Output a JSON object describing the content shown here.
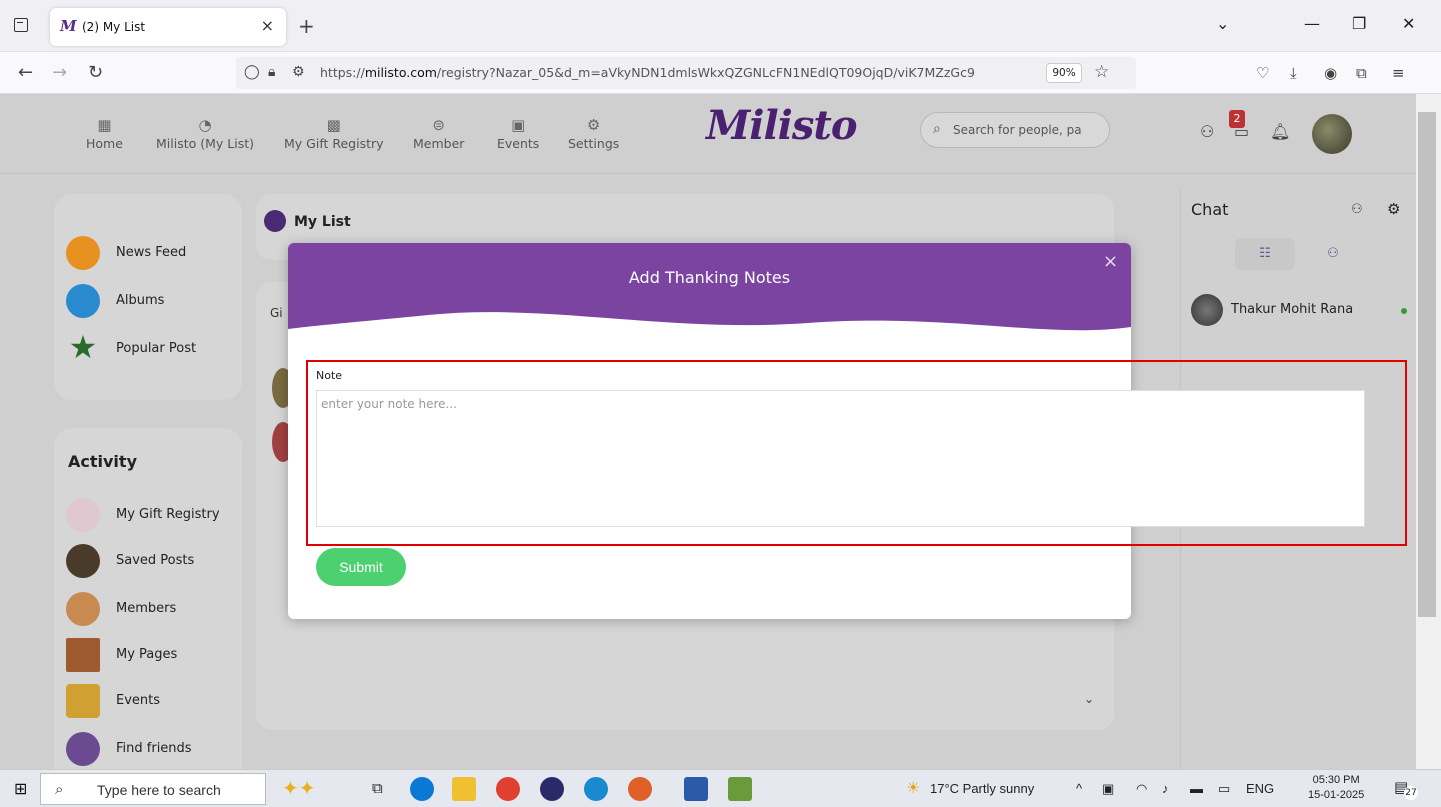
{
  "browser": {
    "tab_title": "(2) My List",
    "tab_favicon": "M",
    "url_prefix": "https://",
    "url_domain": "milisto.com",
    "url_path": "/registry?Nazar_05&d_m=aVkyNDN1dmlsWkxQZGNLcFN1NEdlQT09OjqD/viK7MZzGc9",
    "zoom": "90%"
  },
  "site": {
    "logo": "Milisto",
    "nav": [
      {
        "label": "Home",
        "icon": "grid-icon"
      },
      {
        "label": "Milisto (My List)",
        "icon": "chart-icon"
      },
      {
        "label": "My Gift Registry",
        "icon": "registry-icon"
      },
      {
        "label": "Member",
        "icon": "member-icon"
      },
      {
        "label": "Events",
        "icon": "calendar-icon"
      },
      {
        "label": "Settings",
        "icon": "gear-icon"
      }
    ],
    "search_placeholder": "Search for people, pa",
    "notif_badge": "2"
  },
  "sidebar": {
    "top_items": [
      {
        "label": "News Feed",
        "color": "#e89020"
      },
      {
        "label": "Albums",
        "color": "#2a8ad0"
      },
      {
        "label": "Popular Post",
        "color": "#2a7a2a"
      }
    ],
    "activity_title": "Activity",
    "activity_items": [
      {
        "label": "My Gift Registry"
      },
      {
        "label": "Saved Posts"
      },
      {
        "label": "Members"
      },
      {
        "label": "My Pages"
      },
      {
        "label": "Events"
      },
      {
        "label": "Find friends"
      }
    ]
  },
  "main": {
    "title": "My List",
    "sub_partial": "Gi"
  },
  "chat": {
    "title": "Chat",
    "user": "Thakur Mohit Rana"
  },
  "modal": {
    "title": "Add Thanking Notes",
    "close": "×",
    "note_label": "Note",
    "note_placeholder": "enter your note here...",
    "submit_label": "Submit",
    "header_color": "#7a44a0"
  },
  "taskbar": {
    "search_placeholder": "Type here to search",
    "weather": "17°C  Partly sunny",
    "lang": "ENG",
    "time": "05:30 PM",
    "date": "15-01-2025",
    "notif_count": "27"
  }
}
